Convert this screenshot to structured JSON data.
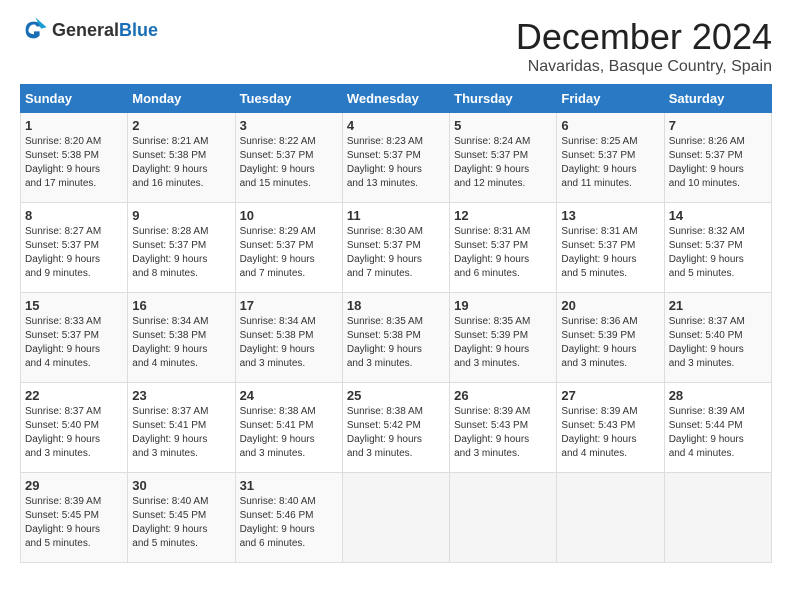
{
  "header": {
    "logo_general": "General",
    "logo_blue": "Blue",
    "month": "December 2024",
    "location": "Navaridas, Basque Country, Spain"
  },
  "weekdays": [
    "Sunday",
    "Monday",
    "Tuesday",
    "Wednesday",
    "Thursday",
    "Friday",
    "Saturday"
  ],
  "weeks": [
    [
      {
        "day": "1",
        "lines": [
          "Sunrise: 8:20 AM",
          "Sunset: 5:38 PM",
          "Daylight: 9 hours",
          "and 17 minutes."
        ]
      },
      {
        "day": "2",
        "lines": [
          "Sunrise: 8:21 AM",
          "Sunset: 5:38 PM",
          "Daylight: 9 hours",
          "and 16 minutes."
        ]
      },
      {
        "day": "3",
        "lines": [
          "Sunrise: 8:22 AM",
          "Sunset: 5:37 PM",
          "Daylight: 9 hours",
          "and 15 minutes."
        ]
      },
      {
        "day": "4",
        "lines": [
          "Sunrise: 8:23 AM",
          "Sunset: 5:37 PM",
          "Daylight: 9 hours",
          "and 13 minutes."
        ]
      },
      {
        "day": "5",
        "lines": [
          "Sunrise: 8:24 AM",
          "Sunset: 5:37 PM",
          "Daylight: 9 hours",
          "and 12 minutes."
        ]
      },
      {
        "day": "6",
        "lines": [
          "Sunrise: 8:25 AM",
          "Sunset: 5:37 PM",
          "Daylight: 9 hours",
          "and 11 minutes."
        ]
      },
      {
        "day": "7",
        "lines": [
          "Sunrise: 8:26 AM",
          "Sunset: 5:37 PM",
          "Daylight: 9 hours",
          "and 10 minutes."
        ]
      }
    ],
    [
      {
        "day": "8",
        "lines": [
          "Sunrise: 8:27 AM",
          "Sunset: 5:37 PM",
          "Daylight: 9 hours",
          "and 9 minutes."
        ]
      },
      {
        "day": "9",
        "lines": [
          "Sunrise: 8:28 AM",
          "Sunset: 5:37 PM",
          "Daylight: 9 hours",
          "and 8 minutes."
        ]
      },
      {
        "day": "10",
        "lines": [
          "Sunrise: 8:29 AM",
          "Sunset: 5:37 PM",
          "Daylight: 9 hours",
          "and 7 minutes."
        ]
      },
      {
        "day": "11",
        "lines": [
          "Sunrise: 8:30 AM",
          "Sunset: 5:37 PM",
          "Daylight: 9 hours",
          "and 7 minutes."
        ]
      },
      {
        "day": "12",
        "lines": [
          "Sunrise: 8:31 AM",
          "Sunset: 5:37 PM",
          "Daylight: 9 hours",
          "and 6 minutes."
        ]
      },
      {
        "day": "13",
        "lines": [
          "Sunrise: 8:31 AM",
          "Sunset: 5:37 PM",
          "Daylight: 9 hours",
          "and 5 minutes."
        ]
      },
      {
        "day": "14",
        "lines": [
          "Sunrise: 8:32 AM",
          "Sunset: 5:37 PM",
          "Daylight: 9 hours",
          "and 5 minutes."
        ]
      }
    ],
    [
      {
        "day": "15",
        "lines": [
          "Sunrise: 8:33 AM",
          "Sunset: 5:37 PM",
          "Daylight: 9 hours",
          "and 4 minutes."
        ]
      },
      {
        "day": "16",
        "lines": [
          "Sunrise: 8:34 AM",
          "Sunset: 5:38 PM",
          "Daylight: 9 hours",
          "and 4 minutes."
        ]
      },
      {
        "day": "17",
        "lines": [
          "Sunrise: 8:34 AM",
          "Sunset: 5:38 PM",
          "Daylight: 9 hours",
          "and 3 minutes."
        ]
      },
      {
        "day": "18",
        "lines": [
          "Sunrise: 8:35 AM",
          "Sunset: 5:38 PM",
          "Daylight: 9 hours",
          "and 3 minutes."
        ]
      },
      {
        "day": "19",
        "lines": [
          "Sunrise: 8:35 AM",
          "Sunset: 5:39 PM",
          "Daylight: 9 hours",
          "and 3 minutes."
        ]
      },
      {
        "day": "20",
        "lines": [
          "Sunrise: 8:36 AM",
          "Sunset: 5:39 PM",
          "Daylight: 9 hours",
          "and 3 minutes."
        ]
      },
      {
        "day": "21",
        "lines": [
          "Sunrise: 8:37 AM",
          "Sunset: 5:40 PM",
          "Daylight: 9 hours",
          "and 3 minutes."
        ]
      }
    ],
    [
      {
        "day": "22",
        "lines": [
          "Sunrise: 8:37 AM",
          "Sunset: 5:40 PM",
          "Daylight: 9 hours",
          "and 3 minutes."
        ]
      },
      {
        "day": "23",
        "lines": [
          "Sunrise: 8:37 AM",
          "Sunset: 5:41 PM",
          "Daylight: 9 hours",
          "and 3 minutes."
        ]
      },
      {
        "day": "24",
        "lines": [
          "Sunrise: 8:38 AM",
          "Sunset: 5:41 PM",
          "Daylight: 9 hours",
          "and 3 minutes."
        ]
      },
      {
        "day": "25",
        "lines": [
          "Sunrise: 8:38 AM",
          "Sunset: 5:42 PM",
          "Daylight: 9 hours",
          "and 3 minutes."
        ]
      },
      {
        "day": "26",
        "lines": [
          "Sunrise: 8:39 AM",
          "Sunset: 5:43 PM",
          "Daylight: 9 hours",
          "and 3 minutes."
        ]
      },
      {
        "day": "27",
        "lines": [
          "Sunrise: 8:39 AM",
          "Sunset: 5:43 PM",
          "Daylight: 9 hours",
          "and 4 minutes."
        ]
      },
      {
        "day": "28",
        "lines": [
          "Sunrise: 8:39 AM",
          "Sunset: 5:44 PM",
          "Daylight: 9 hours",
          "and 4 minutes."
        ]
      }
    ],
    [
      {
        "day": "29",
        "lines": [
          "Sunrise: 8:39 AM",
          "Sunset: 5:45 PM",
          "Daylight: 9 hours",
          "and 5 minutes."
        ]
      },
      {
        "day": "30",
        "lines": [
          "Sunrise: 8:40 AM",
          "Sunset: 5:45 PM",
          "Daylight: 9 hours",
          "and 5 minutes."
        ]
      },
      {
        "day": "31",
        "lines": [
          "Sunrise: 8:40 AM",
          "Sunset: 5:46 PM",
          "Daylight: 9 hours",
          "and 6 minutes."
        ]
      },
      null,
      null,
      null,
      null
    ]
  ]
}
